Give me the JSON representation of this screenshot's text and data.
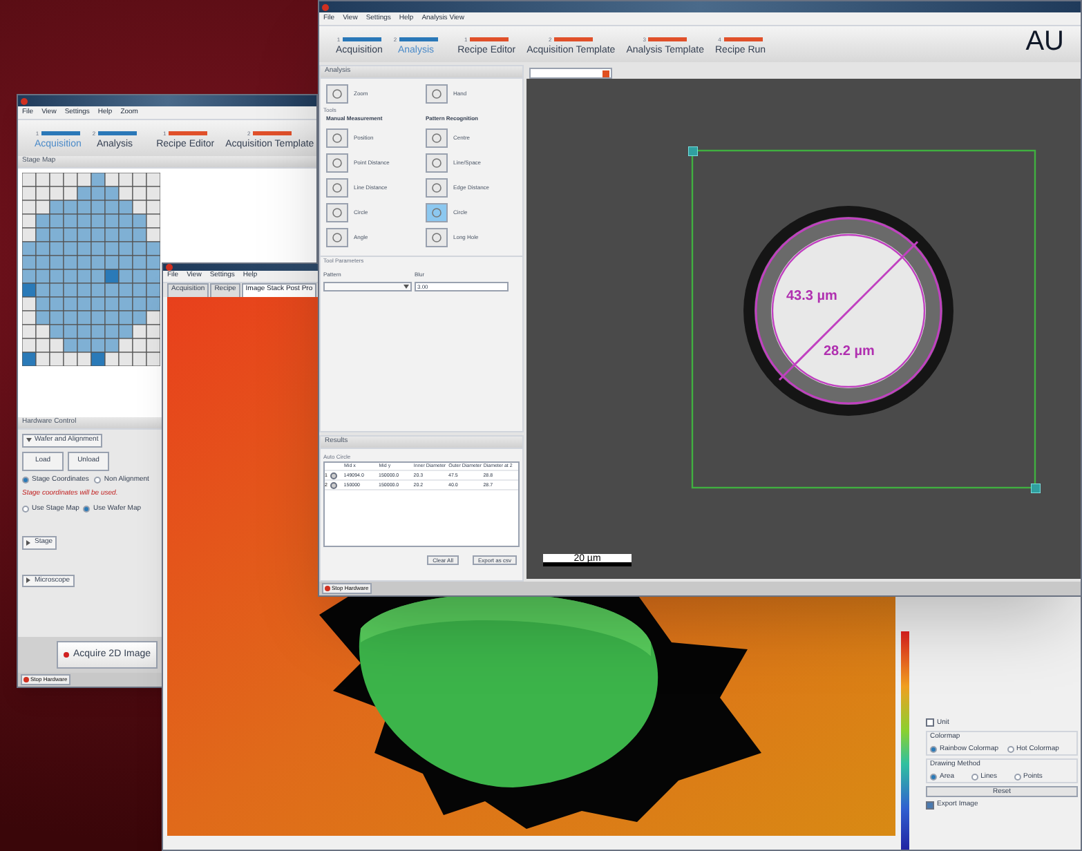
{
  "stage_window": {
    "menu": [
      "File",
      "View",
      "Settings",
      "Help",
      "Zoom"
    ],
    "steps_left": [
      {
        "number": "1",
        "label": "Acquisition",
        "selected": true
      },
      {
        "number": "2",
        "label": "Analysis",
        "selected": false
      }
    ],
    "steps_right": [
      {
        "number": "1",
        "label": "Recipe Editor",
        "selected": false
      },
      {
        "number": "2",
        "label": "Acquisition Template",
        "selected": false
      }
    ],
    "stage_map": {
      "title": "Stage Map"
    },
    "hardware_control": {
      "title": "Hardware Control",
      "sections": [
        {
          "label": "Wafer and Alignment",
          "expanded": true
        },
        {
          "label": "Stage",
          "expanded": false
        },
        {
          "label": "Microscope",
          "expanded": false
        }
      ],
      "buttons": [
        "Load",
        "Unload"
      ],
      "alignment_options": [
        {
          "label": "Stage Coordinates",
          "selected": true
        },
        {
          "label": "Non Alignment",
          "selected": false
        }
      ],
      "note": "Stage coordinates will be used.",
      "map_options": [
        {
          "label": "Use Stage Map",
          "selected": false
        },
        {
          "label": "Use Wafer Map",
          "selected": true
        }
      ]
    },
    "acquire_button": "Acquire 2D Image",
    "stop_button": "Stop Hardware"
  },
  "surface_window": {
    "menu": [
      "File",
      "View",
      "Settings",
      "Help"
    ],
    "tabs": [
      {
        "label": "Acquisition",
        "selected": false
      },
      {
        "label": "Recipe",
        "selected": false
      },
      {
        "label": "Image Stack Post Pro",
        "selected": true
      }
    ],
    "unit": {
      "label": "Unit",
      "checked": false
    },
    "colormap": {
      "title": "Colormap",
      "options": [
        {
          "label": "Rainbow Colormap",
          "selected": true
        },
        {
          "label": "Hot Colormap",
          "selected": false
        }
      ]
    },
    "drawing_method": {
      "title": "Drawing Method",
      "options": [
        {
          "label": "Area",
          "selected": true
        },
        {
          "label": "Lines",
          "selected": false
        },
        {
          "label": "Points",
          "selected": false
        }
      ]
    },
    "reset_button": "Reset",
    "export_image": {
      "label": "Export Image",
      "checked": true
    }
  },
  "main_window": {
    "menu": [
      "File",
      "View",
      "Settings",
      "Help",
      "Analysis View"
    ],
    "logo": "AU",
    "steps_left": [
      {
        "number": "1",
        "label": "Acquisition",
        "selected": false
      },
      {
        "number": "2",
        "label": "Analysis",
        "selected": true
      }
    ],
    "steps_right": [
      {
        "number": "1",
        "label": "Recipe Editor",
        "selected": false
      },
      {
        "number": "2",
        "label": "Acquisition Template",
        "selected": false
      },
      {
        "number": "3",
        "label": "Analysis Template",
        "selected": false
      },
      {
        "number": "4",
        "label": "Recipe Run",
        "selected": false
      }
    ],
    "analysis": {
      "title": "Analysis",
      "nav_tools": [
        {
          "label": "Zoom",
          "selected": false
        },
        {
          "label": "Hand",
          "selected": false
        }
      ],
      "tools_label": "Tools",
      "manual_measurement": {
        "title": "Manual Measurement",
        "tools": [
          {
            "label": "Position",
            "selected": false
          },
          {
            "label": "Point Distance",
            "selected": false
          },
          {
            "label": "Line Distance",
            "selected": false
          },
          {
            "label": "Circle",
            "selected": false
          },
          {
            "label": "Angle",
            "selected": false
          }
        ]
      },
      "pattern_recognition": {
        "title": "Pattern Recognition",
        "tools": [
          {
            "label": "Centre",
            "selected": false
          },
          {
            "label": "Line/Space",
            "selected": false
          },
          {
            "label": "Edge Distance",
            "selected": false
          },
          {
            "label": "Circle",
            "selected": true
          },
          {
            "label": "Long Hole",
            "selected": false
          }
        ]
      },
      "tool_parameters": "Tool Parameters",
      "pattern_label": "Pattern",
      "blur_label": "Blur",
      "blur_value": "3.00"
    },
    "results": {
      "title": "Results",
      "subtitle": "Auto Circle",
      "columns": [
        "Mid x",
        "Mid y",
        "Inner Diameter",
        "Outer Diameter",
        "Diameter at 2"
      ],
      "rows": [
        {
          "index": "1",
          "cells": [
            "149094.0",
            "150000.0",
            "20.3",
            "47.5",
            "28.8"
          ]
        },
        {
          "index": "2",
          "cells": [
            "150000",
            "150000.0",
            "20.2",
            "40.0",
            "28.7"
          ]
        }
      ],
      "buttons": [
        "Clear All",
        "Export as csv"
      ]
    },
    "image": {
      "outer_label": "43.3 µm",
      "inner_label": "28.2 µm",
      "scale_label": "20 µm"
    },
    "stop_button": "Stop Hardware"
  }
}
